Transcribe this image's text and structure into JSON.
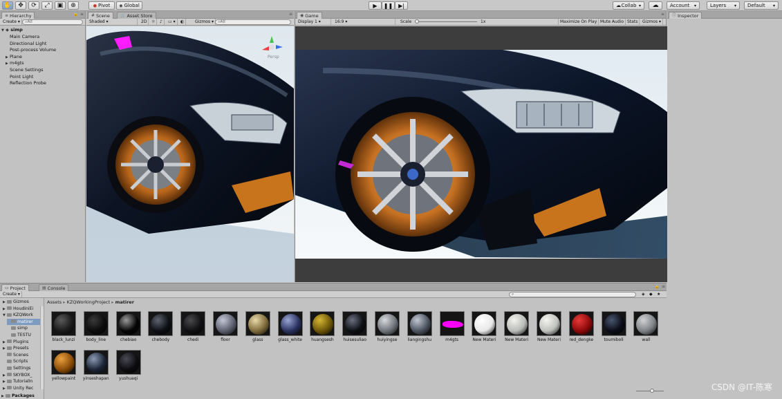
{
  "toolbar": {
    "pivot": "Pivot",
    "global": "Global",
    "collab": "Collab",
    "account": "Account",
    "layers": "Layers",
    "layout": "Default"
  },
  "hierarchy": {
    "tab": "Hierarchy",
    "create": "Create",
    "search_placeholder": "All",
    "scene": "simp",
    "items": [
      {
        "label": "Main Camera",
        "expandable": false
      },
      {
        "label": "Directional Light",
        "expandable": false
      },
      {
        "label": "Post-process Volume",
        "expandable": false
      },
      {
        "label": "Plane",
        "expandable": true
      },
      {
        "label": "m4gts",
        "expandable": true
      },
      {
        "label": "Scene Settings",
        "expandable": false
      },
      {
        "label": "Point Light",
        "expandable": false
      },
      {
        "label": "Reflection Probe",
        "expandable": false
      }
    ]
  },
  "scene": {
    "tab": "Scene",
    "asset_store_tab": "Asset Store",
    "shading": "Shaded",
    "mode_2d": "2D",
    "gizmos": "Gizmos",
    "search_placeholder": "All",
    "persp": "Persp"
  },
  "game": {
    "tab": "Game",
    "display": "Display 1",
    "aspect": "16:9",
    "scale_label": "Scale",
    "scale_value": "1x",
    "maximize": "Maximize On Play",
    "mute": "Mute Audio",
    "stats": "Stats",
    "gizmos": "Gizmos"
  },
  "inspector": {
    "tab": "Inspector"
  },
  "project": {
    "tab": "Project",
    "console_tab": "Console",
    "create": "Create",
    "breadcrumb": [
      "Assets",
      "KZQWorkingProject",
      "matirer"
    ],
    "folders": [
      {
        "label": "Gizmos",
        "indent": 1,
        "arrow": "▶"
      },
      {
        "label": "HoudiniEi",
        "indent": 1,
        "arrow": "▶"
      },
      {
        "label": "KZQWork",
        "indent": 1,
        "arrow": "▼"
      },
      {
        "label": "matirer",
        "indent": 2,
        "arrow": "",
        "selected": true
      },
      {
        "label": "simp",
        "indent": 2,
        "arrow": ""
      },
      {
        "label": "TESTU",
        "indent": 2,
        "arrow": ""
      },
      {
        "label": "Plugins",
        "indent": 1,
        "arrow": "▶"
      },
      {
        "label": "Presets",
        "indent": 1,
        "arrow": "▶"
      },
      {
        "label": "Scenes",
        "indent": 1,
        "arrow": ""
      },
      {
        "label": "Scripts",
        "indent": 1,
        "arrow": ""
      },
      {
        "label": "Settings",
        "indent": 1,
        "arrow": ""
      },
      {
        "label": "SKYBOX_",
        "indent": 1,
        "arrow": "▶"
      },
      {
        "label": "TutorialIn",
        "indent": 1,
        "arrow": "▶"
      },
      {
        "label": "Unity Rec",
        "indent": 1,
        "arrow": "▶"
      }
    ],
    "packages": "Packages",
    "assets": [
      {
        "name": "black_lunzi",
        "color": "#1a1a1a",
        "hl": "#5a5a5a"
      },
      {
        "name": "body_line",
        "color": "#0b0b0b",
        "hl": "#3a3a3a"
      },
      {
        "name": "chebiao",
        "color": "#050505",
        "hl": "#9a9a9a"
      },
      {
        "name": "chebody",
        "color": "#0d0f14",
        "hl": "#5e6470"
      },
      {
        "name": "chedi",
        "color": "#101012",
        "hl": "#4a4a4e"
      },
      {
        "name": "floor",
        "color": "#5c5f6e",
        "hl": "#c4c8d6"
      },
      {
        "name": "glass",
        "color": "#7e6a3a",
        "hl": "#e8d9a8"
      },
      {
        "name": "glass_white",
        "color": "#2a3260",
        "hl": "#9aa6d6"
      },
      {
        "name": "huangsesh",
        "color": "#6e5708",
        "hl": "#d4b632"
      },
      {
        "name": "huisesuliao",
        "color": "#0d0f14",
        "hl": "#6a7080"
      },
      {
        "name": "huiyingse",
        "color": "#6e737a",
        "hl": "#d7dadd"
      },
      {
        "name": "liangingshu",
        "color": "#4c5460",
        "hl": "#c2c8d2"
      },
      {
        "name": "m4gts",
        "color": "#ff00ff",
        "hl": "#ff00ff"
      },
      {
        "name": "New Materi",
        "color": "#e8e8e8",
        "hl": "#ffffff"
      },
      {
        "name": "New Materi",
        "color": "#b9bbb8",
        "hl": "#f2f2ee"
      },
      {
        "name": "New Materi",
        "color": "#bfc1bd",
        "hl": "#f4f4f0"
      },
      {
        "name": "red_dengke",
        "color": "#8d0a0a",
        "hl": "#e83a3a"
      },
      {
        "name": "toumiboli",
        "color": "#0a0d16",
        "hl": "#4a5670"
      },
      {
        "name": "wall",
        "color": "#7e8186",
        "hl": "#d0d2d4"
      },
      {
        "name": "yellowpaint",
        "color": "#8b4c08",
        "hl": "#e8a040"
      },
      {
        "name": "yinseshapan",
        "color": "#1c2536",
        "hl": "#8a9ab4"
      },
      {
        "name": "yushuaqi",
        "color": "#0c0c10",
        "hl": "#4a4a56"
      }
    ]
  },
  "watermark": "CSDN @IT-陈寒"
}
